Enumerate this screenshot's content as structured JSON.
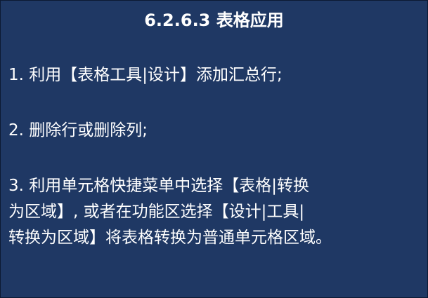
{
  "slide": {
    "title": "6.2.6.3 表格应用",
    "items": [
      {
        "lines": [
          "1. 利用【表格工具|设计】添加汇总行;"
        ]
      },
      {
        "lines": [
          "2. 删除行或删除列;"
        ]
      },
      {
        "lines": [
          "3. 利用单元格快捷菜单中选择【表格|转换",
          "为区域】, 或者在功能区选择【设计|工具|",
          "转换为区域】将表格转换为普通单元格区域。"
        ]
      }
    ]
  },
  "colors": {
    "background": "#1f3864",
    "text": "#ffffff"
  }
}
